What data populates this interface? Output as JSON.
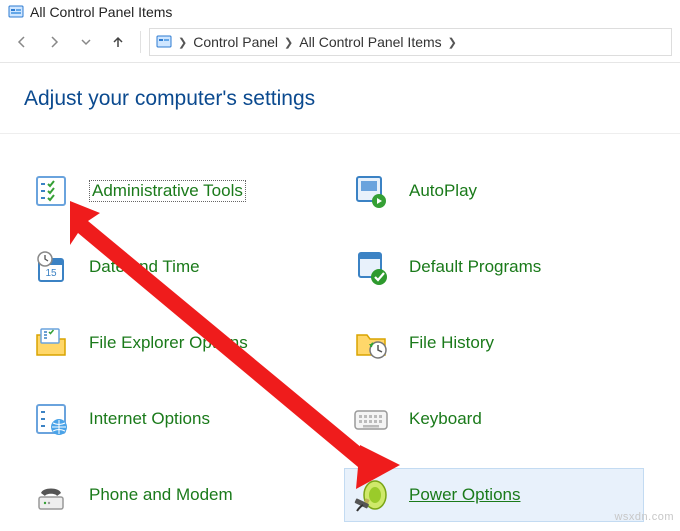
{
  "window": {
    "title": "All Control Panel Items"
  },
  "breadcrumb": {
    "root": "Control Panel",
    "current": "All Control Panel Items"
  },
  "heading": "Adjust your computer's settings",
  "items": [
    {
      "label": "Administrative Tools",
      "icon": "admin-tools-icon",
      "focused": true
    },
    {
      "label": "AutoPlay",
      "icon": "autoplay-icon"
    },
    {
      "label": "Date and Time",
      "icon": "date-time-icon"
    },
    {
      "label": "Default Programs",
      "icon": "default-programs-icon"
    },
    {
      "label": "File Explorer Options",
      "icon": "file-explorer-options-icon"
    },
    {
      "label": "File History",
      "icon": "file-history-icon"
    },
    {
      "label": "Internet Options",
      "icon": "internet-options-icon"
    },
    {
      "label": "Keyboard",
      "icon": "keyboard-icon"
    },
    {
      "label": "Phone and Modem",
      "icon": "phone-modem-icon"
    },
    {
      "label": "Power Options",
      "icon": "power-options-icon",
      "selected": true
    }
  ],
  "watermark": "wsxdn.com"
}
